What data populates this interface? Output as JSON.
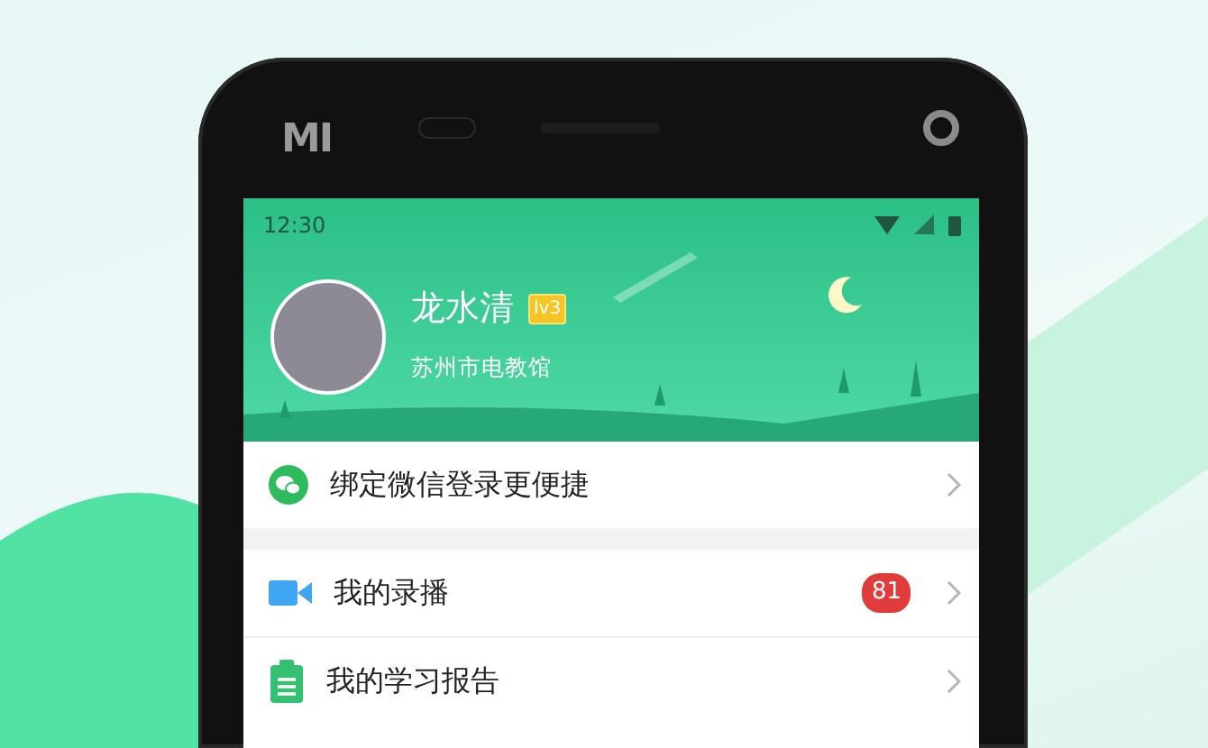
{
  "device": {
    "logo": "MI"
  },
  "status_bar": {
    "time": "12:30"
  },
  "profile": {
    "name": "龙水清",
    "level": "lv3",
    "organization": "苏州市电教馆"
  },
  "menu_groups": [
    {
      "items": [
        {
          "kind": "wechat",
          "label": "绑定微信登录更便捷"
        }
      ]
    },
    {
      "items": [
        {
          "kind": "video",
          "label": "我的录播",
          "badge": "81"
        },
        {
          "kind": "report",
          "label": "我的学习报告"
        }
      ]
    }
  ]
}
